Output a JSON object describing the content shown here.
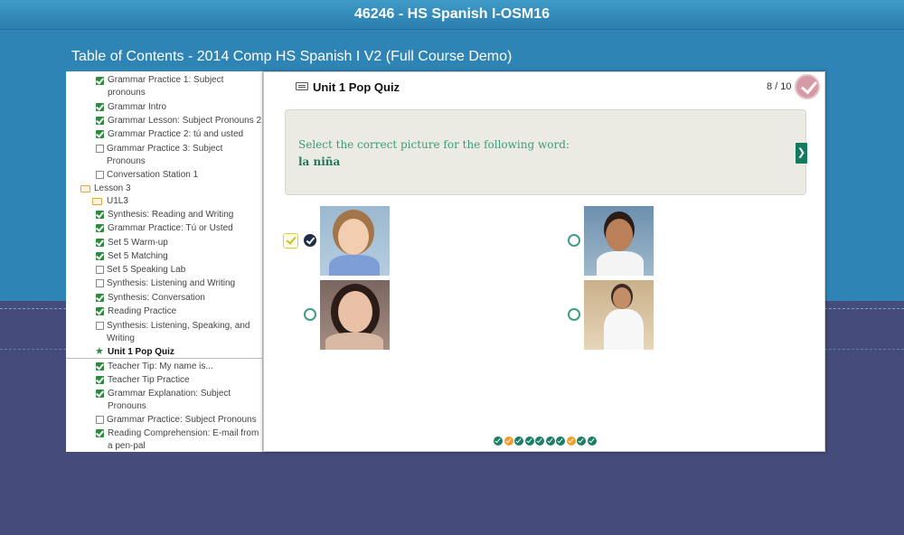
{
  "window_title": "46246 - HS Spanish I-OSM16",
  "toc_heading": "Table of Contents - 2014 Comp HS Spanish I V2 (Full Course Demo)",
  "sidebar": {
    "items": [
      {
        "label": "Grammar Practice 1: Subject",
        "label2": "pronouns",
        "status": "done"
      },
      {
        "label": "Grammar Intro",
        "status": "done"
      },
      {
        "label": "Grammar Lesson: Subject Pronouns 2",
        "status": "done"
      },
      {
        "label": "Grammar Practice 2: tú and usted",
        "status": "done"
      },
      {
        "label": "Grammar Practice 3: Subject",
        "label2": "Pronouns",
        "status": "todo"
      },
      {
        "label": "Conversation Station 1",
        "status": "todo"
      },
      {
        "label": "Lesson 3",
        "status": "folder"
      },
      {
        "label": "U1L3",
        "status": "folder"
      },
      {
        "label": "Synthesis: Reading and Writing",
        "status": "done"
      },
      {
        "label": "Grammar Practice: Tú or Usted",
        "status": "done"
      },
      {
        "label": "Set 5 Warm-up",
        "status": "done"
      },
      {
        "label": "Set 5 Matching",
        "status": "done"
      },
      {
        "label": "Set 5 Speaking Lab",
        "status": "todo"
      },
      {
        "label": "Synthesis: Listening and Writing",
        "status": "todo"
      },
      {
        "label": "Synthesis: Conversation",
        "status": "done"
      },
      {
        "label": "Reading Practice",
        "status": "done"
      },
      {
        "label": "Synthesis: Listening, Speaking, and",
        "label2": "Writing",
        "status": "todo"
      },
      {
        "label": "Unit 1 Pop Quiz",
        "status": "current"
      },
      {
        "label": "Teacher Tip: My name is...",
        "status": "done"
      },
      {
        "label": "Teacher Tip Practice",
        "status": "done"
      },
      {
        "label": "Grammar Explanation: Subject",
        "label2": "Pronouns",
        "status": "done"
      },
      {
        "label": "Grammar Practice: Subject Pronouns",
        "status": "todo"
      },
      {
        "label": "Reading Comprehension: E-mail from",
        "label2": "a pen-pal",
        "status": "done"
      }
    ]
  },
  "quiz": {
    "title": "Unit 1 Pop Quiz",
    "progress": "8 / 10",
    "prompt": "Select the correct picture for the following word:",
    "word": "la niña",
    "next_icon": "❯",
    "options": [
      {
        "name": "girl",
        "selected": true
      },
      {
        "name": "boy",
        "selected": false
      },
      {
        "name": "woman",
        "selected": false
      },
      {
        "name": "man",
        "selected": false
      }
    ],
    "dots": [
      "green",
      "orange",
      "green",
      "green",
      "green",
      "green",
      "green",
      "orange",
      "green",
      "green"
    ]
  },
  "colors": {
    "top_bg": "#2e84b5",
    "bottom_bg": "#454b7a",
    "accent_green": "#1b7d66",
    "accent_orange": "#f39b25"
  }
}
